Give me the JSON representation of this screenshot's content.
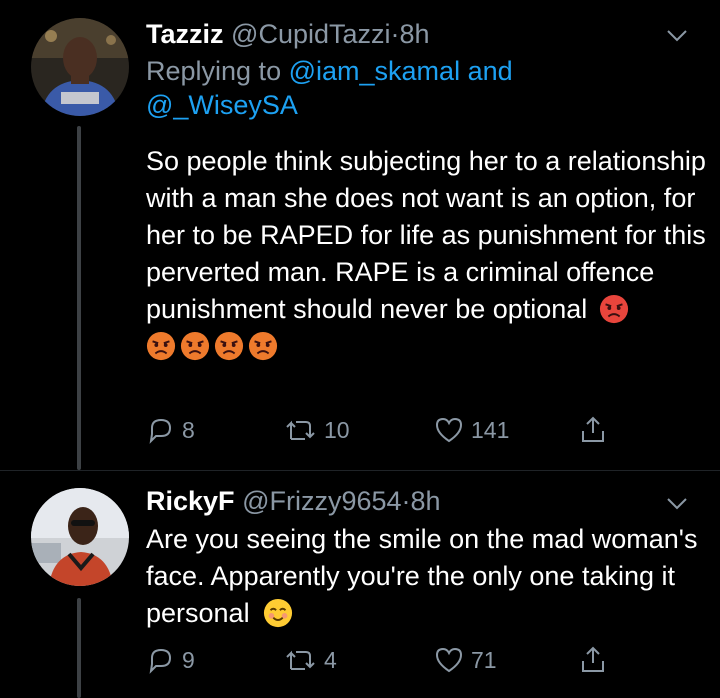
{
  "tweets": [
    {
      "name": "Tazziz",
      "handle": "@CupidTazzi",
      "separator": "·",
      "time": "8h",
      "replying_prefix": "Replying to",
      "replying_to_1": "@iam_skamal",
      "replying_and": "and",
      "replying_to_2": "@_WiseySA",
      "body": "So people think subjecting her to a relationship with a man she does not want is an option, for her to be RAPED for life as punishment for this perverted man. RAPE is a criminal offence punishment should never be optional",
      "emoji_name": "angry-face-emoji",
      "emoji_count": 5,
      "reply_count": "8",
      "retweet_count": "10",
      "like_count": "141"
    },
    {
      "name": "RickyF",
      "handle": "@Frizzy9654",
      "separator": "·",
      "time": "8h",
      "body": "Are you seeing the smile on the mad woman's face. Apparently you're the only one taking it personal",
      "emoji_name": "smiling-blush-emoji",
      "reply_count": "9",
      "retweet_count": "4",
      "like_count": "71"
    }
  ],
  "colors": {
    "background": "#000000",
    "text": "#ffffff",
    "muted": "#8b98a5",
    "link": "#1da1f2",
    "thread_line": "#3d4145"
  }
}
